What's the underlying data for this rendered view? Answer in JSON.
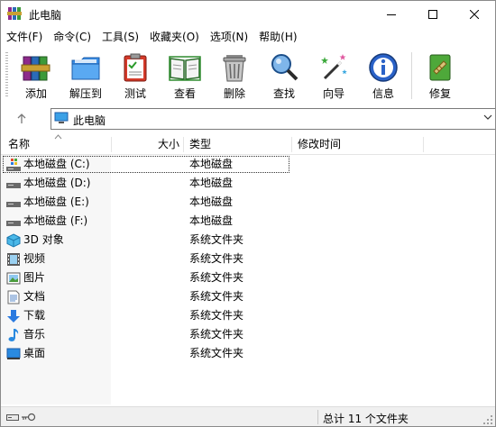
{
  "window": {
    "title": "此电脑"
  },
  "menu": [
    "文件(F)",
    "命令(C)",
    "工具(S)",
    "收藏夹(O)",
    "选项(N)",
    "帮助(H)"
  ],
  "toolbar": {
    "buttons": [
      {
        "label": "添加",
        "icon": "add-books-icon"
      },
      {
        "label": "解压到",
        "icon": "extract-folder-icon"
      },
      {
        "label": "测试",
        "icon": "test-clipboard-icon"
      },
      {
        "label": "查看",
        "icon": "view-book-icon"
      },
      {
        "label": "删除",
        "icon": "delete-trash-icon"
      },
      {
        "label": "查找",
        "icon": "find-magnifier-icon"
      },
      {
        "label": "向导",
        "icon": "wizard-wand-icon"
      },
      {
        "label": "信息",
        "icon": "info-icon"
      },
      {
        "label": "修复",
        "icon": "repair-icon"
      }
    ]
  },
  "address": {
    "path": "此电脑"
  },
  "columns": {
    "name": "名称",
    "size": "大小",
    "type": "类型",
    "modified": "修改时间"
  },
  "rows": [
    {
      "name": "本地磁盘 (C:)",
      "type": "本地磁盘",
      "icon": "system-drive-icon"
    },
    {
      "name": "本地磁盘 (D:)",
      "type": "本地磁盘",
      "icon": "drive-icon"
    },
    {
      "name": "本地磁盘 (E:)",
      "type": "本地磁盘",
      "icon": "drive-icon"
    },
    {
      "name": "本地磁盘 (F:)",
      "type": "本地磁盘",
      "icon": "drive-icon"
    },
    {
      "name": "3D 对象",
      "type": "系统文件夹",
      "icon": "3d-objects-icon"
    },
    {
      "name": "视频",
      "type": "系统文件夹",
      "icon": "videos-icon"
    },
    {
      "name": "图片",
      "type": "系统文件夹",
      "icon": "pictures-icon"
    },
    {
      "name": "文档",
      "type": "系统文件夹",
      "icon": "documents-icon"
    },
    {
      "name": "下载",
      "type": "系统文件夹",
      "icon": "downloads-icon"
    },
    {
      "name": "音乐",
      "type": "系统文件夹",
      "icon": "music-icon"
    },
    {
      "name": "桌面",
      "type": "系统文件夹",
      "icon": "desktop-icon"
    }
  ],
  "status": {
    "text": "总计 11 个文件夹"
  },
  "colors": {
    "accent": "#1e6fd9",
    "window_border": "#8a8a8a",
    "status_bg": "#f0f0f0"
  }
}
